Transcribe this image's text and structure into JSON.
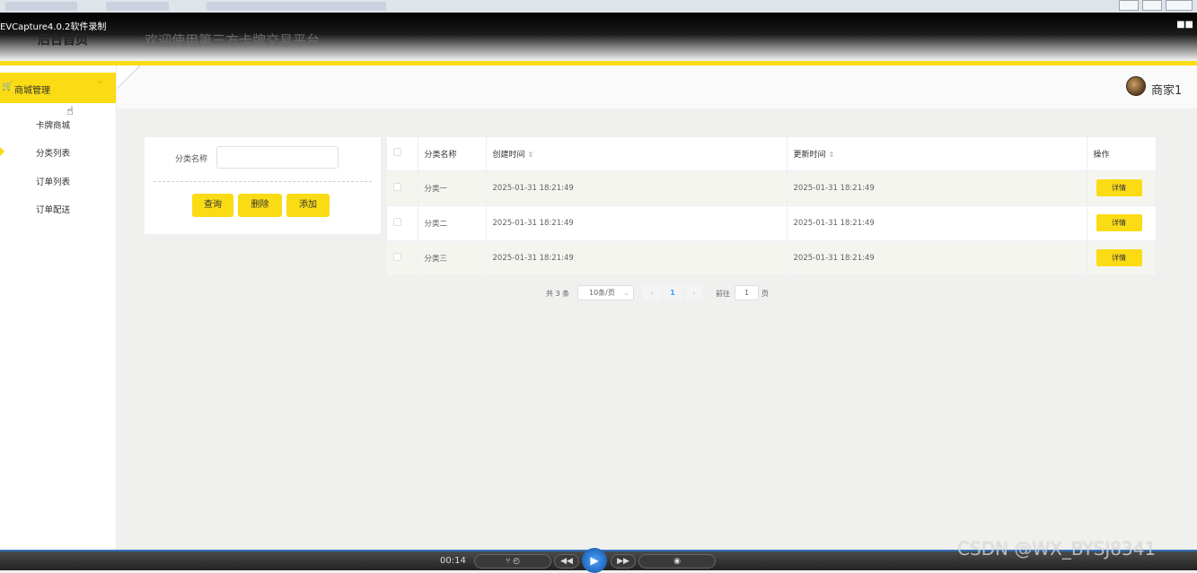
{
  "recorder": {
    "title": "EVCapture4.0.2软件录制"
  },
  "header": {
    "home_title": "后台首页",
    "welcome": "欢迎使用第三方卡牌交易平台"
  },
  "sidebar": {
    "group_label": "商城管理",
    "items": [
      {
        "label": "卡牌商城"
      },
      {
        "label": "分类列表"
      },
      {
        "label": "订单列表"
      },
      {
        "label": "订单配送"
      }
    ]
  },
  "user": {
    "name": "商家1"
  },
  "search": {
    "label": "分类名称",
    "value": "",
    "buttons": {
      "query": "查询",
      "delete": "删除",
      "add": "添加"
    }
  },
  "table": {
    "headers": {
      "name": "分类名称",
      "created": "创建时间",
      "updated": "更新时间",
      "action": "操作"
    },
    "rows": [
      {
        "name": "分类一",
        "created": "2025-01-31 18:21:49",
        "updated": "2025-01-31 18:21:49",
        "action": "详情"
      },
      {
        "name": "分类二",
        "created": "2025-01-31 18:21:49",
        "updated": "2025-01-31 18:21:49",
        "action": "详情"
      },
      {
        "name": "分类三",
        "created": "2025-01-31 18:21:49",
        "updated": "2025-01-31 18:21:49",
        "action": "详情"
      }
    ]
  },
  "pagination": {
    "total": "共 3 条",
    "page_size": "10条/页",
    "current": "1",
    "goto_label": "前往",
    "goto_value": "1",
    "page_suffix": "页"
  },
  "player": {
    "time": "00:14"
  },
  "watermark": "CSDN @WX_BYSJ8341",
  "colors": {
    "accent": "#fadb14",
    "link": "#409eff"
  }
}
